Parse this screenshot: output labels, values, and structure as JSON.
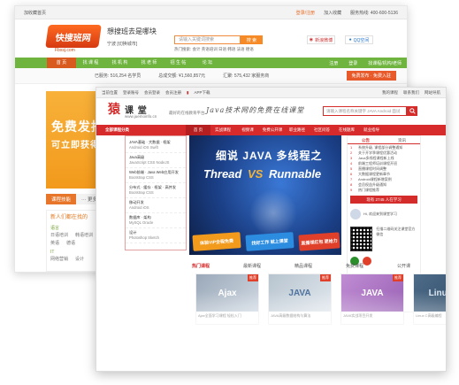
{
  "back_window": {
    "topbar": {
      "left_text": "加收藏首页",
      "links": [
        "登录/注册",
        "加入收藏",
        "服务热线: 400-600-5136"
      ]
    },
    "logo_text": "快搜班网",
    "site_url": "Fbxsj.com",
    "title": "想搜班去是哪块",
    "city": "宁波 [切换城市]",
    "search": {
      "placeholder": "请输入关键词搜索",
      "button": "搜 索"
    },
    "hotwords": "热门搜索:  会计   英语培训   日语   韩语   法语   德语",
    "social": {
      "weibo": "新浪微博",
      "qq": "QQ空间"
    },
    "nav": [
      "首 页",
      "找 课 程",
      "找 机 构",
      "找 老 师",
      "招 生 帖",
      "论 坛"
    ],
    "nav_right": [
      "注册",
      "登录",
      "找课程/机构/老师"
    ],
    "stats": [
      "已服务: 516,254 名学员",
      "总成交额: ¥1,560,857元",
      "汇聚: 575,432 家服务商"
    ],
    "stats_cta": "免费发布 · 免费入驻",
    "banner": {
      "line1": "免费发招",
      "line2": "可立即获得"
    },
    "skill_bar": {
      "tag": "课程技能",
      "more": "··· 更多"
    },
    "sidebar": {
      "header": "新人们都在找的",
      "sections": [
        {
          "title": "语言",
          "rows": [
            [
              "日语培训",
              "韩语培训",
              "法语"
            ],
            [
              "英语",
              "德语"
            ]
          ]
        },
        {
          "title": "IT",
          "rows": [
            [
              "网络营销",
              "设计"
            ]
          ]
        }
      ]
    }
  },
  "front_window": {
    "topbar": {
      "left": [
        "当前位置",
        "登录账号",
        "会员登录",
        "会员注册"
      ],
      "app": "APP下载",
      "right": [
        "我的课程",
        "联系我们",
        "网站导航"
      ]
    },
    "logo": {
      "text": "课 堂",
      "url": "www.juemoinfo.cn",
      "tagline": "最好的在线教育平台"
    },
    "slogan": "Java技术网的免费在线课堂",
    "search": {
      "placeholder": "请输入课程名称关键字 JAVA Android 面试"
    },
    "nav": {
      "category": "全部课程分类",
      "items": [
        "首 页",
        "实战课程",
        "视频课",
        "免费公开课",
        "职业路径",
        "社区问答",
        "在线题库",
        "就业指导"
      ]
    },
    "left_menu": [
      {
        "title": "JAVA基础 · 大数据 · 框架",
        "sub": "Android  iOS  Swift"
      },
      {
        "title": "Java高级",
        "sub": "JavaScript  CSS  NodeJS"
      },
      {
        "title": "Web前端 · Java Web应用开发",
        "sub": "Bootstrap  CSS"
      },
      {
        "title": "分布式 · 缓存 · 框架 · 高并发",
        "sub": "Bootstrap  CSS"
      },
      {
        "title": "移动开发",
        "sub": "Android  iOS"
      },
      {
        "title": "数据库 · 架构",
        "sub": "MySQL  Oracle"
      },
      {
        "title": "设计",
        "sub": "Photoshop  Sketch"
      }
    ],
    "hero": {
      "line1": "细说 JAVA 多线程之",
      "line2_left": "Thread",
      "line2_vs": "VS",
      "line2_right": "Runnable",
      "badges": [
        "体验VIP全程免费",
        "找好工作 就上课堂",
        "直播领红包 更给力"
      ]
    },
    "right_panel": {
      "tabs": [
        "公告",
        "资讯"
      ],
      "news": [
        {
          "num": "1",
          "text": "系统升级, 课程部分调整通知"
        },
        {
          "num": "2",
          "text": "关于开学季课程优惠活动"
        },
        {
          "num": "3",
          "text": "Java多线程课程新上线"
        },
        {
          "num": "4",
          "text": "前端工程师培训课程开班"
        },
        {
          "num": "5",
          "text": "直播课程时间调整"
        },
        {
          "num": "6",
          "text": "大数据课程更新章节"
        },
        {
          "num": "7",
          "text": "Android课程新增案例"
        },
        {
          "num": "8",
          "text": "会员权益升级通知"
        },
        {
          "num": "9",
          "text": "热门课程推荐"
        }
      ],
      "signup": "现有 2745 人在学习",
      "teacher": "Hi, 欢迎来到课堂学习",
      "qr_text": "扫描二维码关注课堂官方微信",
      "socials": [
        "weixin-icon",
        "weibo-icon"
      ]
    },
    "sections": [
      "热门课程",
      "最新课程",
      "精品课程",
      "免费课程",
      "公开课"
    ],
    "cards": [
      {
        "thumb": "Ajax",
        "cap": "Ajax全面学习课程 轻松入门",
        "corner": "推荐"
      },
      {
        "thumb": "JAVA",
        "cap": "JAVA高级数据结构与算法",
        "corner": "推荐"
      },
      {
        "thumb": "JAVA",
        "cap": "JAVA实战项目开发",
        "corner": "推荐"
      },
      {
        "thumb": "Linux C",
        "cap": "Linux C高级编程",
        "corner": "推荐"
      }
    ]
  }
}
